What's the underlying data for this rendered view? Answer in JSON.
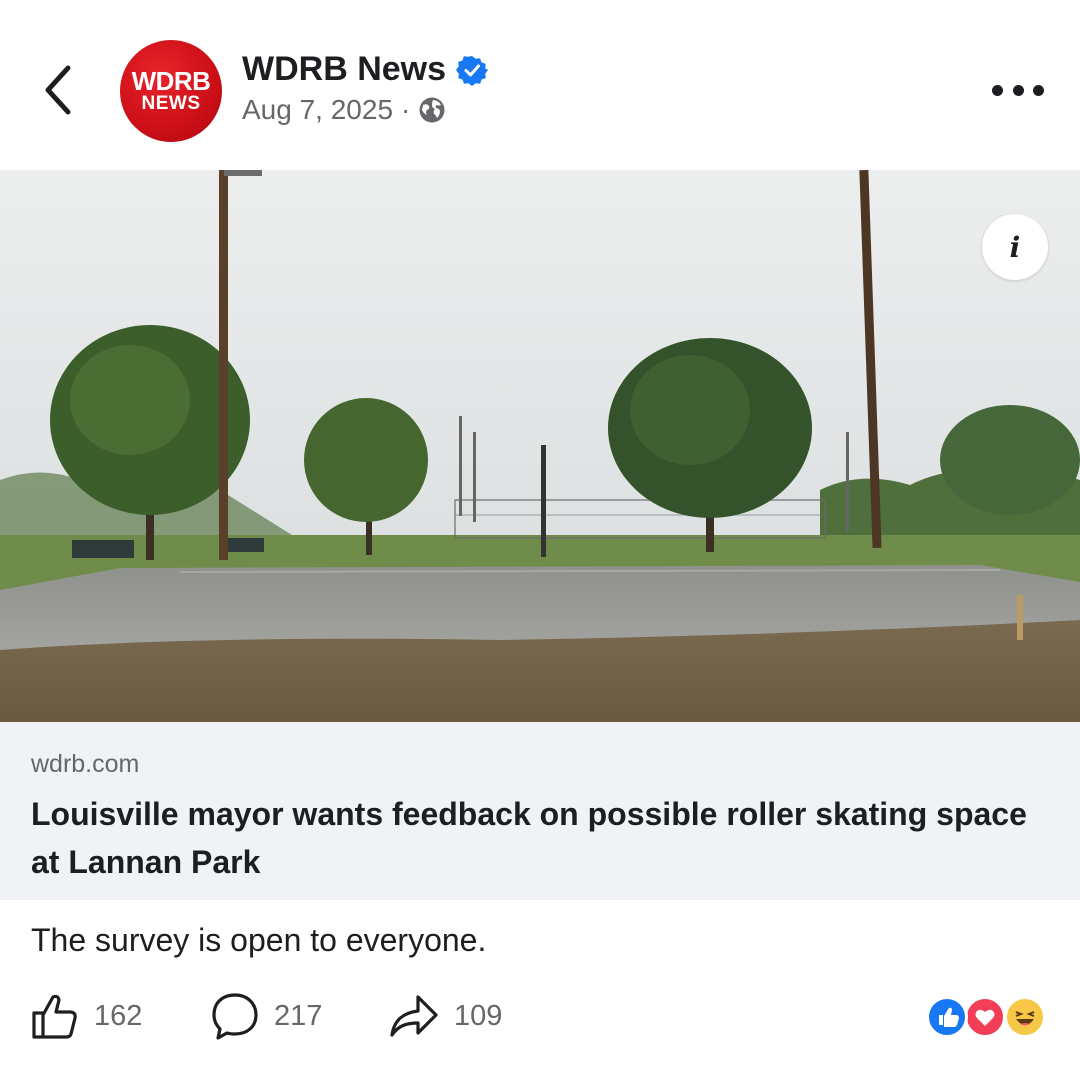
{
  "post": {
    "page_name": "WDRB News",
    "avatar_text_line1": "WDRB",
    "avatar_text_line2": "NEWS",
    "date": "Aug 7, 2025",
    "separator": "·",
    "verified_icon": "verified-badge-icon",
    "privacy_icon": "globe-icon",
    "caption": "The survey is open to everyone."
  },
  "link_preview": {
    "domain": "wdrb.com",
    "headline": "Louisville mayor wants feedback on possible roller skating space at Lannan Park"
  },
  "actions": {
    "like_count": "162",
    "comment_count": "217",
    "share_count": "109"
  },
  "reactions": [
    "like",
    "love",
    "haha"
  ],
  "colors": {
    "brand_red": "#cc0f17",
    "verified_blue": "#1877f2",
    "link_card_bg": "#f0f2f5",
    "secondary_text": "#65676b"
  }
}
